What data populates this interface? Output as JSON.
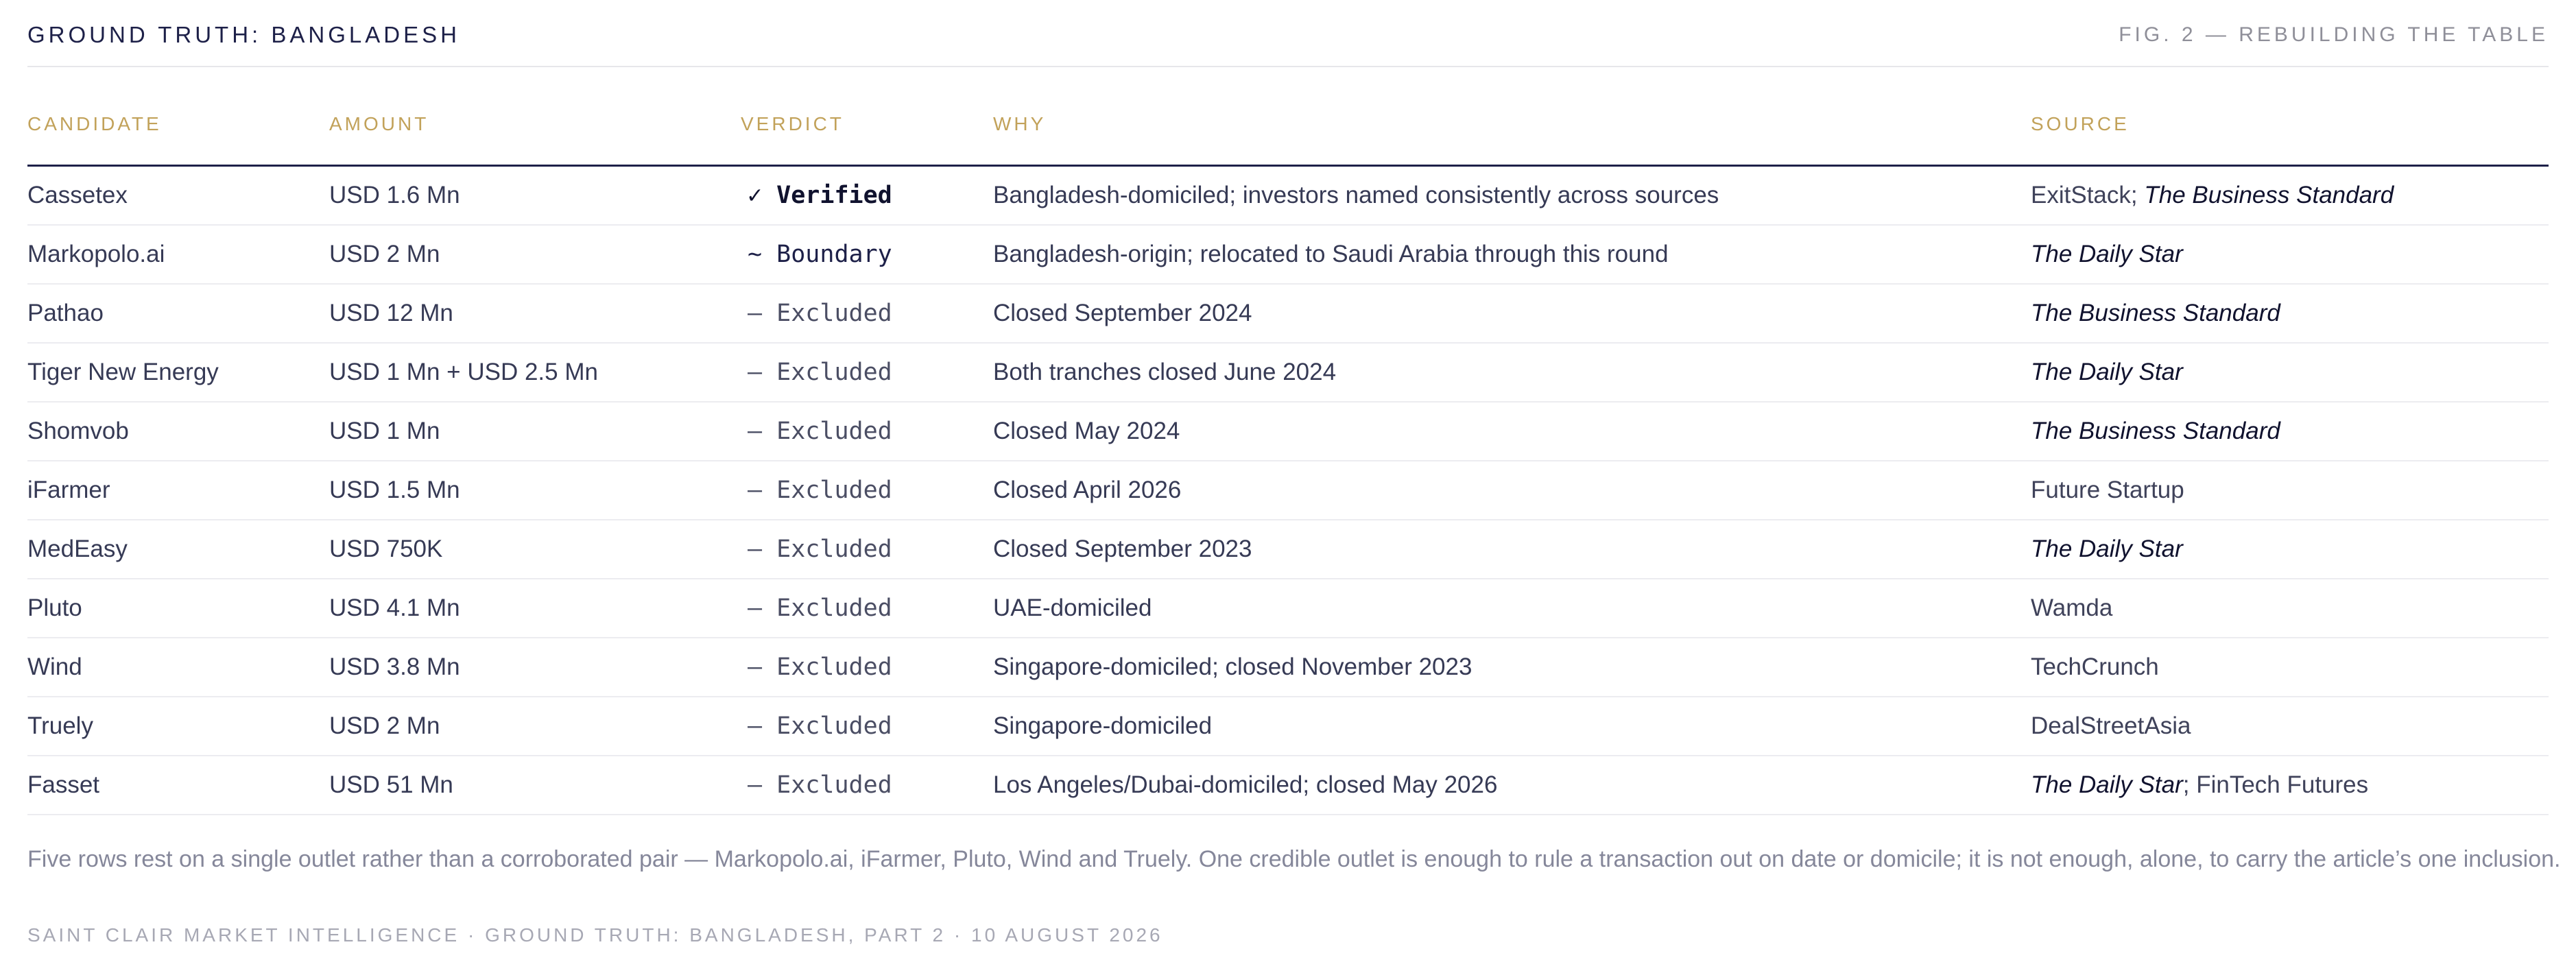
{
  "header": {
    "title": "GROUND TRUTH: BANGLADESH",
    "figure_label": "FIG. 2 — REBUILDING THE TABLE"
  },
  "table": {
    "columns": [
      "CANDIDATE",
      "AMOUNT",
      "VERDICT",
      "WHY",
      "SOURCE"
    ],
    "rows": [
      {
        "candidate": "Cassetex",
        "amount": "USD 1.6 Mn",
        "verdict_mark": "✓",
        "verdict": "Verified",
        "verdict_kind": "verified",
        "why": "Bangladesh-domiciled; investors named consistently across sources",
        "source": [
          {
            "text": "ExitStack",
            "italic": false
          },
          {
            "text": "; ",
            "italic": false
          },
          {
            "text": "The Business Standard",
            "italic": true
          }
        ]
      },
      {
        "candidate": "Markopolo.ai",
        "amount": "USD 2 Mn",
        "verdict_mark": "~",
        "verdict": "Boundary",
        "verdict_kind": "boundary",
        "why": "Bangladesh-origin; relocated to Saudi Arabia through this round",
        "source": [
          {
            "text": "The Daily Star",
            "italic": true
          }
        ]
      },
      {
        "candidate": "Pathao",
        "amount": "USD 12 Mn",
        "verdict_mark": "–",
        "verdict": "Excluded",
        "verdict_kind": "excluded",
        "why": "Closed September 2024",
        "source": [
          {
            "text": "The Business Standard",
            "italic": true
          }
        ]
      },
      {
        "candidate": "Tiger New Energy",
        "amount": "USD 1 Mn + USD 2.5 Mn",
        "verdict_mark": "–",
        "verdict": "Excluded",
        "verdict_kind": "excluded",
        "why": "Both tranches closed June 2024",
        "source": [
          {
            "text": "The Daily Star",
            "italic": true
          }
        ]
      },
      {
        "candidate": "Shomvob",
        "amount": "USD 1 Mn",
        "verdict_mark": "–",
        "verdict": "Excluded",
        "verdict_kind": "excluded",
        "why": "Closed May 2024",
        "source": [
          {
            "text": "The Business Standard",
            "italic": true
          }
        ]
      },
      {
        "candidate": "iFarmer",
        "amount": "USD 1.5 Mn",
        "verdict_mark": "–",
        "verdict": "Excluded",
        "verdict_kind": "excluded",
        "why": "Closed April 2026",
        "source": [
          {
            "text": "Future Startup",
            "italic": false
          }
        ]
      },
      {
        "candidate": "MedEasy",
        "amount": "USD 750K",
        "verdict_mark": "–",
        "verdict": "Excluded",
        "verdict_kind": "excluded",
        "why": "Closed September 2023",
        "source": [
          {
            "text": "The Daily Star",
            "italic": true
          }
        ]
      },
      {
        "candidate": "Pluto",
        "amount": "USD 4.1 Mn",
        "verdict_mark": "–",
        "verdict": "Excluded",
        "verdict_kind": "excluded",
        "why": "UAE-domiciled",
        "source": [
          {
            "text": "Wamda",
            "italic": false
          }
        ]
      },
      {
        "candidate": "Wind",
        "amount": "USD 3.8 Mn",
        "verdict_mark": "–",
        "verdict": "Excluded",
        "verdict_kind": "excluded",
        "why": "Singapore-domiciled; closed November 2023",
        "source": [
          {
            "text": "TechCrunch",
            "italic": false
          }
        ]
      },
      {
        "candidate": "Truely",
        "amount": "USD 2 Mn",
        "verdict_mark": "–",
        "verdict": "Excluded",
        "verdict_kind": "excluded",
        "why": "Singapore-domiciled",
        "source": [
          {
            "text": "DealStreetAsia",
            "italic": false
          }
        ]
      },
      {
        "candidate": "Fasset",
        "amount": "USD 51 Mn",
        "verdict_mark": "–",
        "verdict": "Excluded",
        "verdict_kind": "excluded",
        "why": "Los Angeles/Dubai-domiciled; closed May 2026",
        "source": [
          {
            "text": "The Daily Star",
            "italic": true
          },
          {
            "text": "; FinTech Futures",
            "italic": false
          }
        ]
      }
    ]
  },
  "footnote": "Five rows rest on a single outlet rather than a corroborated pair — Markopolo.ai, iFarmer, Pluto, Wind and Truely. One credible outlet is enough to rule a transaction out on date or domicile; it is not enough, alone, to carry the article’s one inclusion.",
  "colophon": "SAINT CLAIR MARKET INTELLIGENCE · GROUND TRUTH: BANGLADESH, PART 2 · 10 AUGUST 2026"
}
